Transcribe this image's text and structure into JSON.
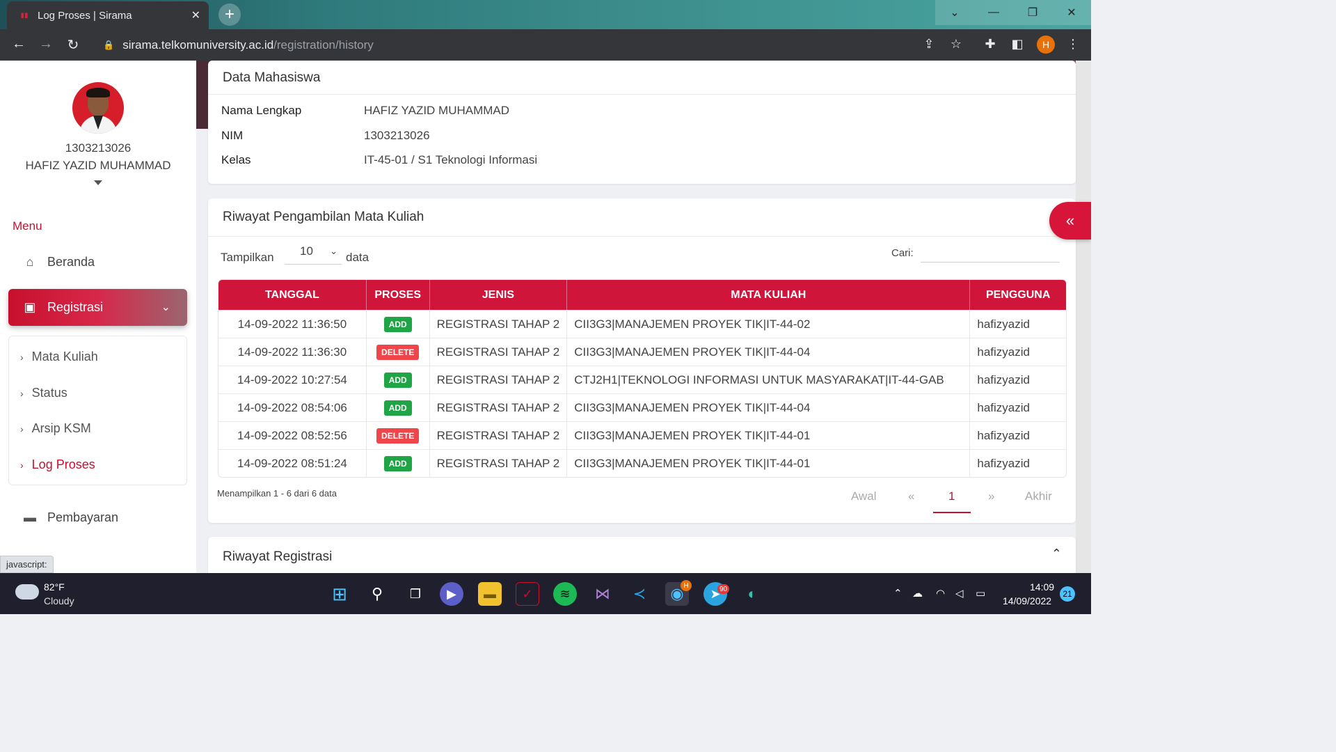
{
  "browser": {
    "tab_title": "Log Proses | Sirama",
    "url_host": "sirama.telkomuniversity.ac.id",
    "url_path": "/registration/history",
    "profile_initial": "H",
    "status_text": "javascript:"
  },
  "sidebar": {
    "nim": "1303213026",
    "name": "HAFIZ YAZID MUHAMMAD",
    "menu_title": "Menu",
    "items": [
      {
        "label": "Beranda",
        "icon": "home-icon"
      },
      {
        "label": "Registrasi",
        "icon": "registration-icon"
      },
      {
        "label": "Pembayaran",
        "icon": "card-icon"
      }
    ],
    "submenu": [
      {
        "label": "Mata Kuliah"
      },
      {
        "label": "Status"
      },
      {
        "label": "Arsip KSM"
      },
      {
        "label": "Log Proses",
        "active": true
      }
    ]
  },
  "student_card": {
    "title": "Data Mahasiswa",
    "rows": [
      {
        "label": "Nama Lengkap",
        "value": "HAFIZ YAZID MUHAMMAD"
      },
      {
        "label": "NIM",
        "value": "1303213026"
      },
      {
        "label": "Kelas",
        "value": "IT-45-01 / S1 Teknologi Informasi"
      }
    ]
  },
  "history_card": {
    "title": "Riwayat Pengambilan Mata Kuliah",
    "show_label": "Tampilkan",
    "page_size": "10",
    "data_label": "data",
    "search_label": "Cari:",
    "search_value": "",
    "columns": [
      "TANGGAL",
      "PROSES",
      "JENIS",
      "MATA KULIAH",
      "PENGGUNA"
    ],
    "rows": [
      {
        "date": "14-09-2022 11:36:50",
        "process": "ADD",
        "type": "REGISTRASI TAHAP 2",
        "course": "CII3G3|MANAJEMEN PROYEK TIK|IT-44-02",
        "user": "hafizyazid"
      },
      {
        "date": "14-09-2022 11:36:30",
        "process": "DELETE",
        "type": "REGISTRASI TAHAP 2",
        "course": "CII3G3|MANAJEMEN PROYEK TIK|IT-44-04",
        "user": "hafizyazid"
      },
      {
        "date": "14-09-2022 10:27:54",
        "process": "ADD",
        "type": "REGISTRASI TAHAP 2",
        "course": "CTJ2H1|TEKNOLOGI INFORMASI UNTUK MASYARAKAT|IT-44-GAB",
        "user": "hafizyazid"
      },
      {
        "date": "14-09-2022 08:54:06",
        "process": "ADD",
        "type": "REGISTRASI TAHAP 2",
        "course": "CII3G3|MANAJEMEN PROYEK TIK|IT-44-04",
        "user": "hafizyazid"
      },
      {
        "date": "14-09-2022 08:52:56",
        "process": "DELETE",
        "type": "REGISTRASI TAHAP 2",
        "course": "CII3G3|MANAJEMEN PROYEK TIK|IT-44-01",
        "user": "hafizyazid"
      },
      {
        "date": "14-09-2022 08:51:24",
        "process": "ADD",
        "type": "REGISTRASI TAHAP 2",
        "course": "CII3G3|MANAJEMEN PROYEK TIK|IT-44-01",
        "user": "hafizyazid"
      }
    ],
    "info": "Menampilkan 1 - 6 dari 6 data",
    "pagination": {
      "first": "Awal",
      "prev": "«",
      "current": "1",
      "next": "»",
      "last": "Akhir"
    }
  },
  "registration_card": {
    "title": "Riwayat Registrasi"
  },
  "taskbar": {
    "temperature": "82°F",
    "weather": "Cloudy",
    "time": "14:09",
    "date": "14/09/2022",
    "notifications": "21",
    "chrome_badge": "H",
    "telegram_badge": "90"
  },
  "colors": {
    "accent": "#c8102e",
    "add": "#1fa446",
    "delete": "#f0454a"
  }
}
